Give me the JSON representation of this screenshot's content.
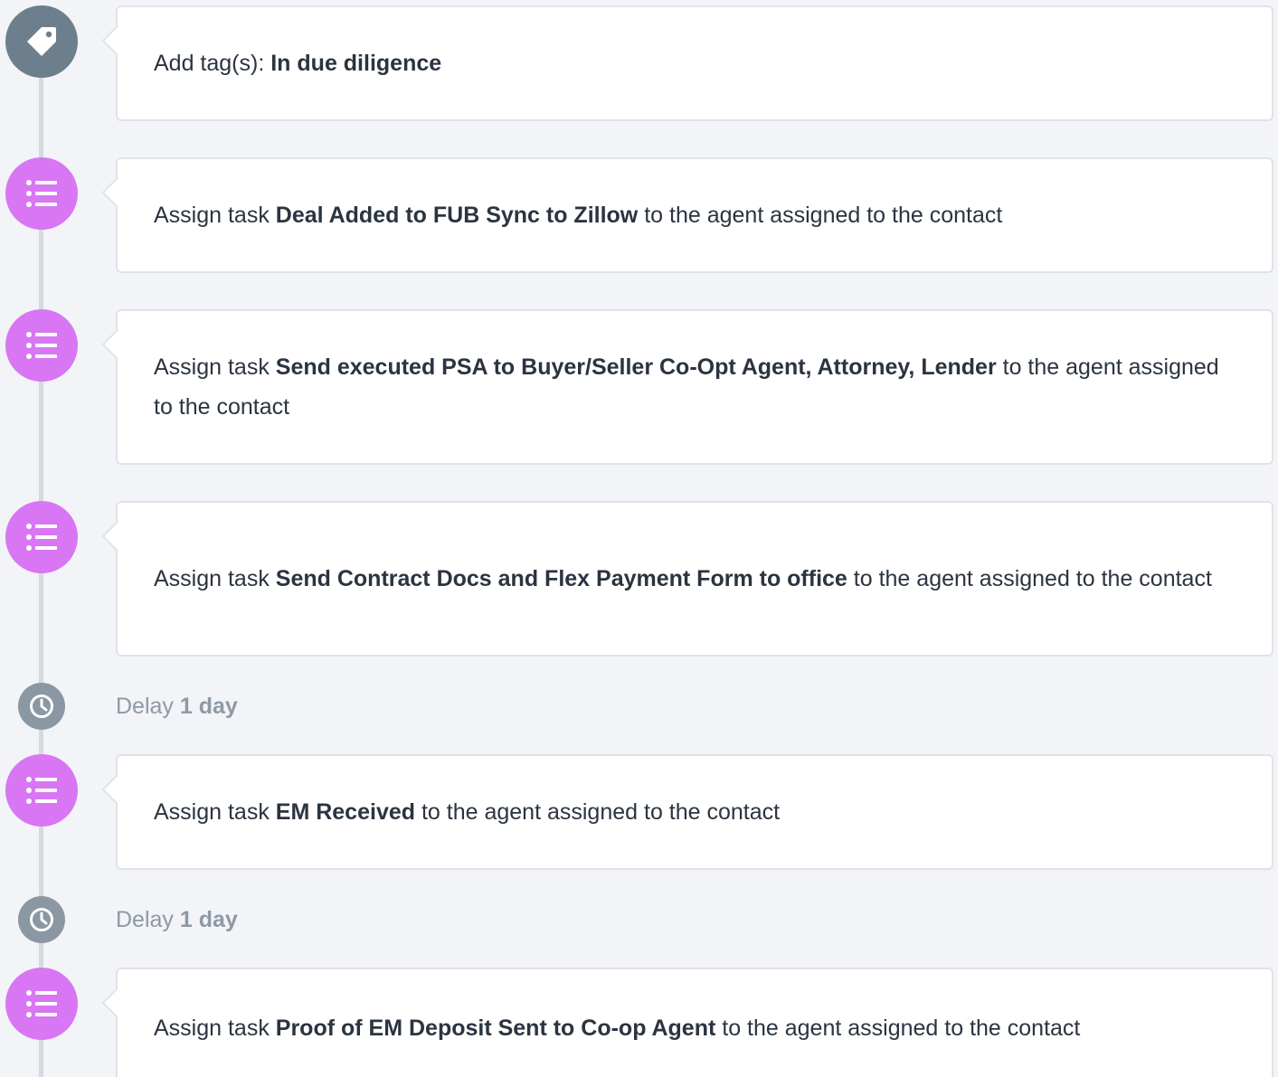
{
  "steps": [
    {
      "type": "action",
      "prefix": "Add tag(s): ",
      "bold": "In due diligence",
      "suffix": ""
    },
    {
      "type": "action",
      "prefix": "Assign task ",
      "bold": "Deal Added to FUB Sync to Zillow",
      "suffix": " to the agent assigned to the contact"
    },
    {
      "type": "action",
      "prefix": "Assign task ",
      "bold": "Send executed PSA to Buyer/Seller Co-Opt Agent, Attorney, Lender",
      "suffix": " to the agent assigned to the contact"
    },
    {
      "type": "action",
      "prefix": "Assign task ",
      "bold": "Send Contract Docs and Flex Payment Form to office",
      "suffix": " to the agent assigned to the contact"
    },
    {
      "type": "delay",
      "label": "Delay ",
      "value": "1 day"
    },
    {
      "type": "action",
      "prefix": "Assign task ",
      "bold": "EM Received",
      "suffix": " to the agent assigned to the contact"
    },
    {
      "type": "delay",
      "label": "Delay ",
      "value": "1 day"
    },
    {
      "type": "action",
      "prefix": "Assign task ",
      "bold": "Proof of EM Deposit Sent to Co-op Agent",
      "suffix": " to the agent assigned to the contact"
    }
  ],
  "icons": {
    "tag": "tag-icon",
    "task": "task-list-icon",
    "delay": "clock-icon"
  },
  "colors": {
    "tag_icon_bg": "#6d7f8d",
    "task_icon_bg": "#d876f4",
    "delay_icon_bg": "#8b97a3",
    "background": "#f2f4f8",
    "card_border": "#dfe3e8"
  }
}
